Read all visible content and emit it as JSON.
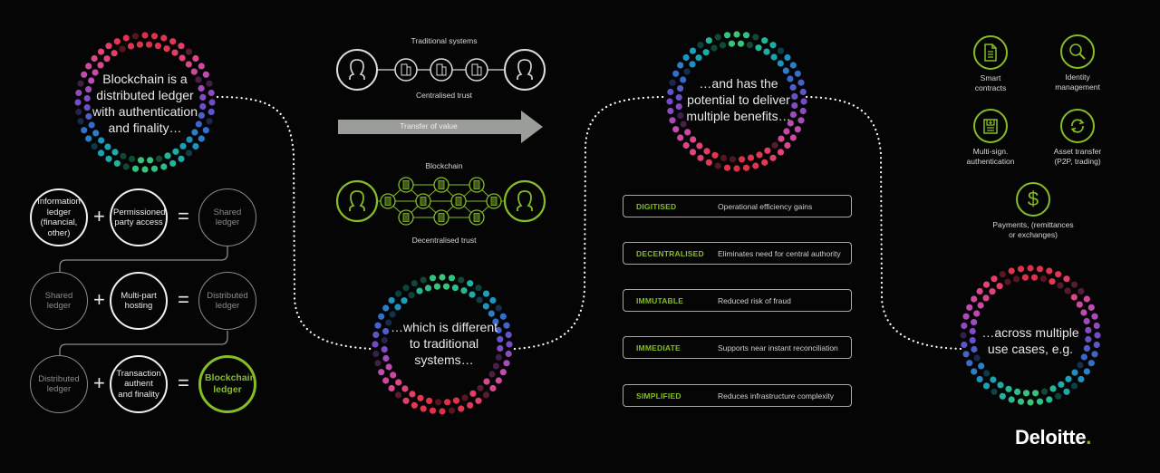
{
  "colors": {
    "background": "#050505",
    "accent_green": "#86bc25",
    "text": "#e6e6e6",
    "muted": "#8c8c8c",
    "arrow": "#9a9d98"
  },
  "rings": [
    {
      "id": "ring-1",
      "lines": [
        "Blockchain is a",
        "distributed ledger",
        "with authentication",
        "and finality…"
      ]
    },
    {
      "id": "ring-2",
      "lines": [
        "…which is different",
        "to traditional",
        "systems…"
      ]
    },
    {
      "id": "ring-3",
      "lines": [
        "…and has the",
        "potential to deliver",
        "multiple benefits…"
      ]
    },
    {
      "id": "ring-4",
      "lines": [
        "…across multiple",
        "use cases, e.g."
      ]
    }
  ],
  "equations": [
    {
      "a": "Information ledger (financial, other)",
      "b": "Permissioned party access",
      "result": "Shared ledger",
      "plus": "+",
      "equals": "="
    },
    {
      "a": "Shared ledger",
      "b": "Multi-part hosting",
      "result": "Distributed ledger",
      "plus": "+",
      "equals": "="
    },
    {
      "a": "Distributed ledger",
      "b": "Transaction authent and finality",
      "result": "Blockchain ledger",
      "plus": "+",
      "equals": "="
    }
  ],
  "traditional": {
    "title": "Traditional systems",
    "caption": "Centralised trust",
    "icons": [
      "person-icon",
      "building-icon",
      "building-icon",
      "building-icon",
      "person-icon"
    ]
  },
  "transfer": {
    "label": "Transfer of value"
  },
  "blockchain": {
    "title": "Blockchain",
    "caption": "Decentralised trust",
    "icons": [
      "person-icon",
      "block-icon",
      "person-icon"
    ]
  },
  "benefits": [
    {
      "key": "DIGITISED",
      "value": "Operational efficiency gains"
    },
    {
      "key": "DECENTRALISED",
      "value": "Eliminates need for central authority"
    },
    {
      "key": "IMMUTABLE",
      "value": "Reduced risk of fraud"
    },
    {
      "key": "IMMEDIATE",
      "value": "Supports near instant reconciliation"
    },
    {
      "key": "SIMPLIFIED",
      "value": "Reduces infrastructure complexity"
    }
  ],
  "use_cases": [
    {
      "icon": "document-icon",
      "lines": [
        "Smart",
        "contracts"
      ]
    },
    {
      "icon": "search-icon",
      "lines": [
        "Identity",
        "management"
      ]
    },
    {
      "icon": "signature-icon",
      "lines": [
        "Multi-sign.",
        "authentication"
      ]
    },
    {
      "icon": "refresh-icon",
      "lines": [
        "Asset transfer",
        "(P2P, trading)"
      ]
    },
    {
      "icon": "dollar-icon",
      "lines": [
        "Payments, (remittances",
        "or exchanges)"
      ]
    }
  ],
  "logo": {
    "text": "Deloitte",
    "dot": "."
  }
}
